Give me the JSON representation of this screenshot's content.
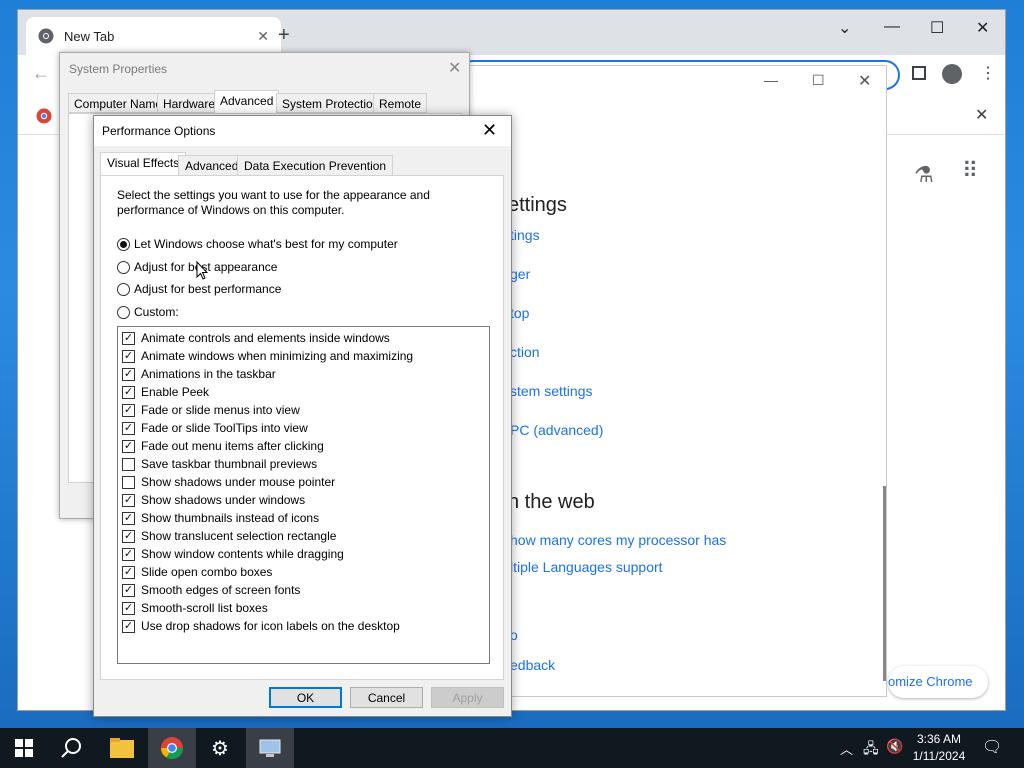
{
  "chrome": {
    "tab_title": "New Tab",
    "settings_heading_1": "ettings",
    "settings_heading_2": "n the web",
    "links": [
      "tings",
      "ger",
      "top",
      "ction",
      "stem settings",
      "PC (advanced)"
    ],
    "web_links": [
      "how many cores my processor has",
      "ltiple Languages support",
      "o",
      "edback"
    ],
    "customize": "omize Chrome"
  },
  "system_properties": {
    "title": "System Properties",
    "tabs": [
      "Computer Name",
      "Hardware",
      "Advanced",
      "System Protection",
      "Remote"
    ],
    "active_tab": "Advanced"
  },
  "performance_options": {
    "title": "Performance Options",
    "tabs": [
      "Visual Effects",
      "Advanced",
      "Data Execution Prevention"
    ],
    "active_tab": "Visual Effects",
    "description": "Select the settings you want to use for the appearance and performance of Windows on this computer.",
    "options": [
      {
        "label": "Let Windows choose what's best for my computer",
        "selected": true
      },
      {
        "label": "Adjust for best appearance",
        "selected": false
      },
      {
        "label": "Adjust for best performance",
        "selected": false
      },
      {
        "label": "Custom:",
        "selected": false
      }
    ],
    "effects": [
      {
        "label": "Animate controls and elements inside windows",
        "checked": true
      },
      {
        "label": "Animate windows when minimizing and maximizing",
        "checked": true
      },
      {
        "label": "Animations in the taskbar",
        "checked": true
      },
      {
        "label": "Enable Peek",
        "checked": true
      },
      {
        "label": "Fade or slide menus into view",
        "checked": true
      },
      {
        "label": "Fade or slide ToolTips into view",
        "checked": true
      },
      {
        "label": "Fade out menu items after clicking",
        "checked": true
      },
      {
        "label": "Save taskbar thumbnail previews",
        "checked": false
      },
      {
        "label": "Show shadows under mouse pointer",
        "checked": false
      },
      {
        "label": "Show shadows under windows",
        "checked": true
      },
      {
        "label": "Show thumbnails instead of icons",
        "checked": true
      },
      {
        "label": "Show translucent selection rectangle",
        "checked": true
      },
      {
        "label": "Show window contents while dragging",
        "checked": true
      },
      {
        "label": "Slide open combo boxes",
        "checked": true
      },
      {
        "label": "Smooth edges of screen fonts",
        "checked": true
      },
      {
        "label": "Smooth-scroll list boxes",
        "checked": true
      },
      {
        "label": "Use drop shadows for icon labels on the desktop",
        "checked": true
      }
    ],
    "buttons": {
      "ok": "OK",
      "cancel": "Cancel",
      "apply": "Apply"
    }
  },
  "taskbar": {
    "time": "3:36 AM",
    "date": "1/11/2024"
  }
}
